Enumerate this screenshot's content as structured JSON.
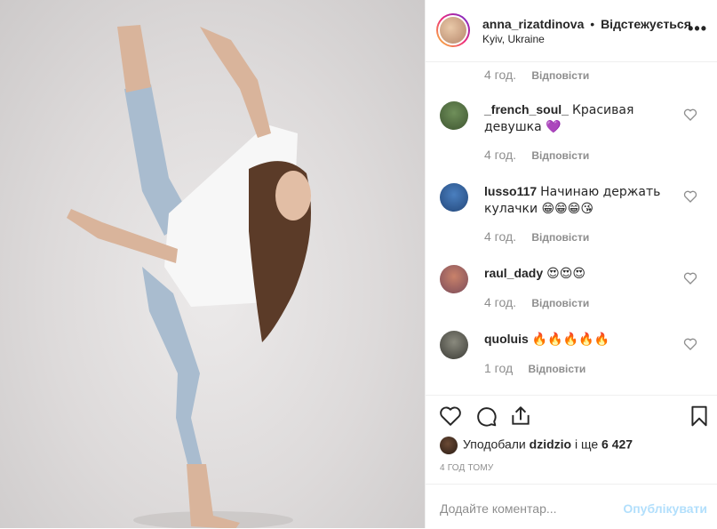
{
  "header": {
    "username": "anna_rizatdinova",
    "separator": "•",
    "follow_status": "Відстежується",
    "location": "Kyiv, Ukraine",
    "more_label": "•••"
  },
  "comments": [
    {
      "time": "4 год.",
      "reply": "Відповісти"
    },
    {
      "username": "_french_soul_",
      "text": "Красивая девушка 💜",
      "time": "4 год.",
      "reply": "Відповісти"
    },
    {
      "username": "lusso117",
      "text": "Начинаю держать кулачки 😁😁😁😘",
      "time": "4 год.",
      "reply": "Відповісти"
    },
    {
      "username": "raul_dady",
      "text": "😍😍😍",
      "time": "4 год.",
      "reply": "Відповісти"
    },
    {
      "username": "quoluis",
      "text": "🔥🔥🔥🔥🔥",
      "time": "1 год",
      "reply": "Відповісти"
    }
  ],
  "likes": {
    "prefix": "Уподобали",
    "user": "dzidzio",
    "middle": "і ще",
    "count": "6 427"
  },
  "posted_ago": "4 ГОД ТОМУ",
  "add_comment": {
    "placeholder": "Додайте коментар...",
    "publish_label": "Опублікувати"
  },
  "icons": [
    "heart-icon",
    "comment-icon",
    "share-icon",
    "bookmark-icon"
  ],
  "colors": {
    "publish_disabled": "#b2dffc",
    "muted": "#8e8e8e",
    "text": "#262626"
  }
}
